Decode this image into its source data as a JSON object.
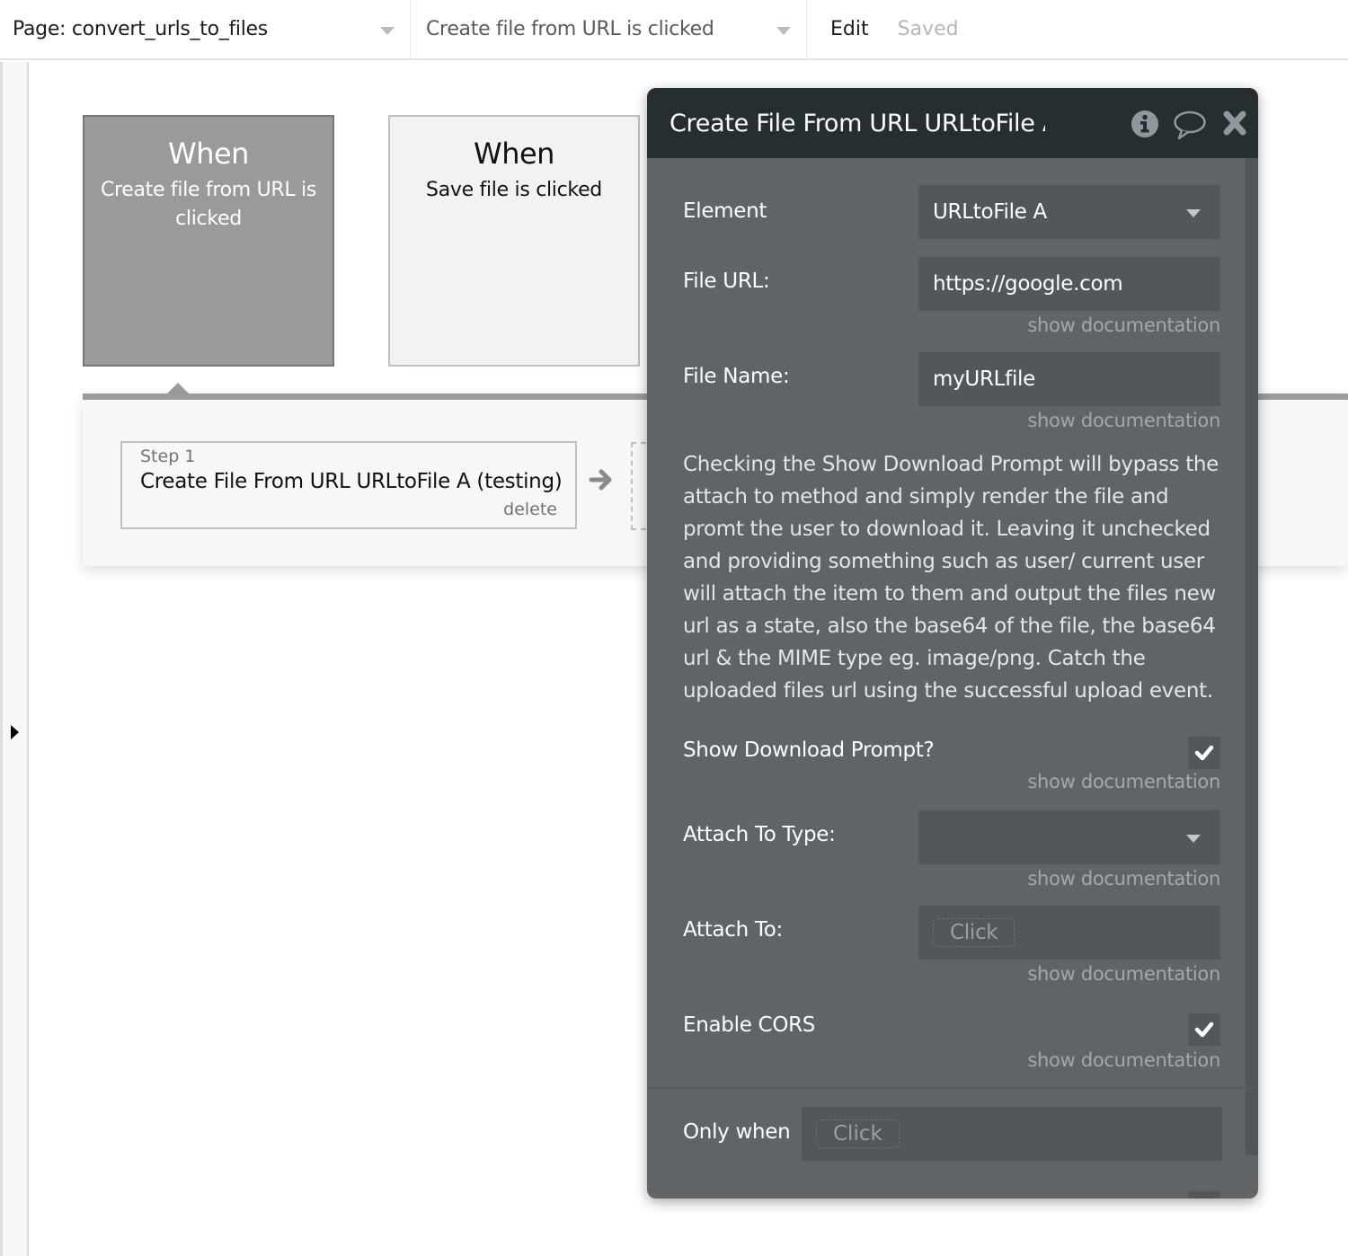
{
  "topbar": {
    "page_selector": "Page: convert_urls_to_files",
    "event_selector": "Create file from URL is clicked",
    "edit_label": "Edit",
    "status": "Saved"
  },
  "events": [
    {
      "when": "When",
      "description": "Create file from URL is clicked",
      "selected": true
    },
    {
      "when": "When",
      "description": "Save file is clicked",
      "selected": false
    }
  ],
  "actions": {
    "steps": [
      {
        "number_label": "Step 1",
        "title": "Create File From URL URLtoFile A (testing)",
        "delete_label": "delete"
      }
    ]
  },
  "panel": {
    "title": "Create File From URL URLtoFile A (testing)",
    "icons": [
      "info-icon",
      "comment-icon",
      "close-icon"
    ],
    "doc_link": "show documentation",
    "fields": {
      "element": {
        "label": "Element",
        "value": "URLtoFile A"
      },
      "file_url": {
        "label": "File URL:",
        "value": "https://google.com"
      },
      "file_name": {
        "label": "File Name:",
        "value": "myURLfile"
      },
      "explanation": "Checking the Show Download Prompt will bypass the attach to method and simply render the file and promt the user to download it. Leaving it unchecked and providing something such as user/ current user will attach the item to them and output the files new url as a state, also the base64 of the file, the base64 url & the MIME type eg. image/png. Catch the uploaded files url using the successful upload event.",
      "show_download_prompt": {
        "label": "Show Download Prompt?",
        "checked": true
      },
      "attach_to_type": {
        "label": "Attach To Type:",
        "value": ""
      },
      "attach_to": {
        "label": "Attach To:",
        "placeholder": "Click"
      },
      "enable_cors": {
        "label": "Enable CORS",
        "checked": true
      }
    },
    "only_when": {
      "label": "Only when",
      "placeholder": "Click"
    }
  },
  "colors": {
    "panel_bg": "#5f6468",
    "panel_header": "#272e31",
    "field_bg": "#52575b",
    "selected_event": "#9a9a9a"
  }
}
